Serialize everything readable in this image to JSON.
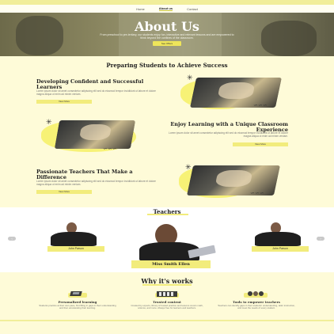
{
  "nav": {
    "items": [
      "Home",
      "About us",
      "Contact"
    ],
    "active": "About us"
  },
  "hero": {
    "title": "About Us",
    "subtitle": "From preschool to pre-tertiary, our students enjoy fun, interactive and relevant lessons and are empowered to think beyond the confines of the classroom.",
    "button": "See Offers"
  },
  "preparing": {
    "title": "Preparing Students to Achieve Success",
    "blocks": [
      {
        "title": "Developing Confident and Successful Learners",
        "text": "Lorem ipsum dolor sit amet consectetur adipiscing elit sed do eiusmod tempor incididunt ut labore et dolore magna aliqua ut enim ad minim veniam.",
        "button": "View More"
      },
      {
        "title": "Enjoy Learning with a Unique Classroom Experience",
        "text": "Lorem ipsum dolor sit amet consectetur adipiscing elit sed do eiusmod tempor incididunt ut labore et dolore magna aliqua ut enim ad minim veniam.",
        "button": "View More"
      },
      {
        "title": "Passionate Teachers That Make a Difference",
        "text": "Lorem ipsum dolor sit amet consectetur adipiscing elit sed do eiusmod tempor incididunt ut labore et dolore magna aliqua ut enim ad minim veniam.",
        "button": "View More"
      }
    ]
  },
  "teachers": {
    "title": "Teachers",
    "prev_icon": "chevron-left-icon",
    "next_icon": "chevron-right-icon",
    "items": [
      {
        "name": "John Parson"
      },
      {
        "name": "Miss Smith Ellen"
      },
      {
        "name": "John Parson"
      }
    ]
  },
  "why": {
    "title": "Why it's works",
    "features": [
      {
        "icon": "personalized-learning-icon",
        "title": "Personalized learning",
        "text": "Students practice at their own pace, first filling in gaps in their understanding and then accelerating their learning."
      },
      {
        "icon": "trusted-content-icon",
        "title": "Trusted content",
        "text": "Created by experts, library of trusted practice and lessons covers math, science, and more. Always free for learners and teachers."
      },
      {
        "icon": "teacher-tools-icon",
        "title": "Tools to empower teachers",
        "text": "Teachers can identify gaps in their students' understanding, tailor instruction, and meet the needs of every student."
      }
    ]
  },
  "colors": {
    "accent": "#f2ec7c",
    "background": "#fefbd8",
    "text": "#222222"
  }
}
